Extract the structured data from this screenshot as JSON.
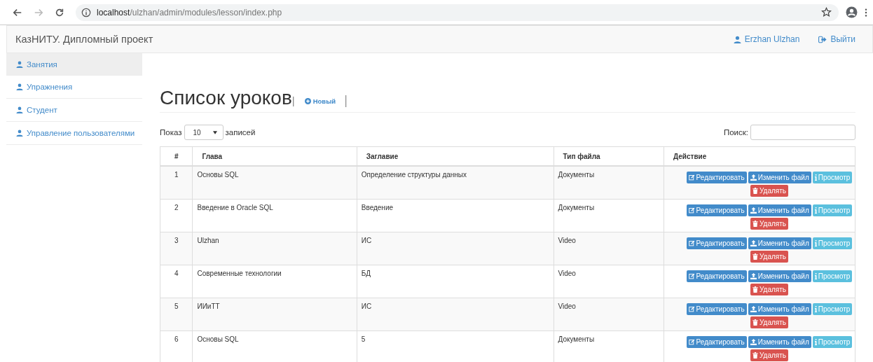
{
  "browser": {
    "url_host": "localhost",
    "url_path": "/ulzhan/admin/modules/lesson/index.php"
  },
  "navbar": {
    "brand": "КазНИТУ. Дипломный проект",
    "user": "Erzhan Ulzhan",
    "logout": "Выйти"
  },
  "sidebar": {
    "items": [
      {
        "label": "Занятия",
        "selected": true
      },
      {
        "label": "Упражнения",
        "selected": false
      },
      {
        "label": "Студент",
        "selected": false
      },
      {
        "label": "Управление пользователями",
        "selected": false
      }
    ]
  },
  "page": {
    "title": "Список уроков",
    "separator": "|",
    "new_button": "Новый",
    "separator_2": "|"
  },
  "length": {
    "before": "Показ",
    "value": "10",
    "after": "записей"
  },
  "search": {
    "label": "Поиск:"
  },
  "table": {
    "columns": [
      "#",
      "Глава",
      "Заглавие",
      "Тип файла",
      "Действие"
    ],
    "rows": [
      {
        "cells": [
          "1",
          "Основы SQL",
          "Определение структуры данных",
          "Документы"
        ],
        "actions": [
          {
            "kind": "edit",
            "label": "Редактировать"
          },
          {
            "kind": "upload",
            "label": "Изменить файл"
          },
          {
            "kind": "view",
            "label": "Просмотр"
          },
          {
            "kind": "delete",
            "label": "Удалять"
          }
        ]
      },
      {
        "cells": [
          "2",
          "Введение в Oracle SQL",
          "Введение",
          "Документы"
        ],
        "actions": [
          {
            "kind": "edit",
            "label": "Редактировать"
          },
          {
            "kind": "upload",
            "label": "Изменить файл"
          },
          {
            "kind": "view",
            "label": "Просмотр"
          },
          {
            "kind": "delete",
            "label": "Удалять"
          }
        ]
      },
      {
        "cells": [
          "3",
          "Ulzhan",
          "ИС",
          "Video"
        ],
        "actions": [
          {
            "kind": "edit",
            "label": "Редактировать"
          },
          {
            "kind": "upload",
            "label": "Изменить файл"
          },
          {
            "kind": "view",
            "label": "Просмотр"
          },
          {
            "kind": "delete",
            "label": "Удалять"
          }
        ]
      },
      {
        "cells": [
          "4",
          "Современные технологии",
          "БД",
          "Video"
        ],
        "actions": [
          {
            "kind": "edit",
            "label": "Редактировать"
          },
          {
            "kind": "upload",
            "label": "Изменить файл"
          },
          {
            "kind": "view",
            "label": "Просмотр"
          },
          {
            "kind": "delete",
            "label": "Удалять"
          }
        ]
      },
      {
        "cells": [
          "5",
          "ИИиТТ",
          "ИС",
          "Video"
        ],
        "actions": [
          {
            "kind": "edit",
            "label": "Редактировать"
          },
          {
            "kind": "upload",
            "label": "Изменить файл"
          },
          {
            "kind": "view",
            "label": "Просмотр"
          },
          {
            "kind": "delete",
            "label": "Удалять"
          }
        ]
      },
      {
        "cells": [
          "6",
          "Основы SQL",
          "5",
          "Документы"
        ],
        "actions": [
          {
            "kind": "edit",
            "label": "Редактировать"
          },
          {
            "kind": "upload",
            "label": "Изменить файл"
          },
          {
            "kind": "view",
            "label": "Просмотр"
          },
          {
            "kind": "delete",
            "label": "Удалять"
          }
        ]
      }
    ]
  }
}
